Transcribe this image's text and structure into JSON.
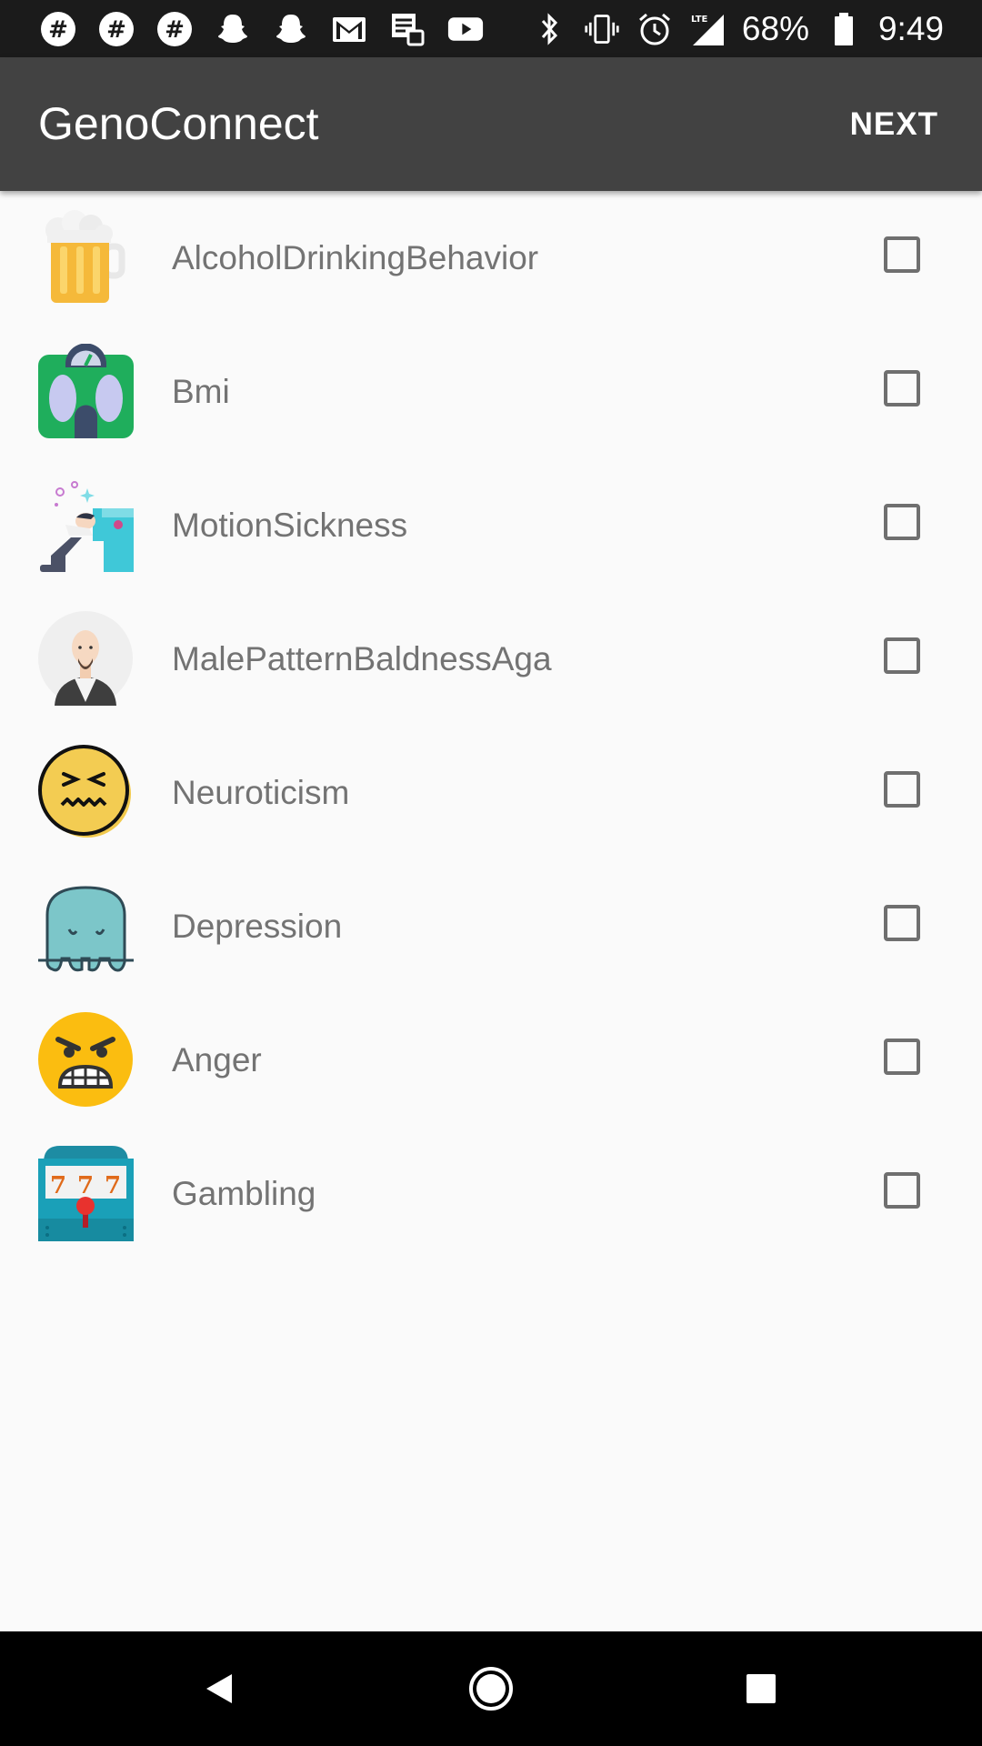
{
  "status_bar": {
    "left_icons": [
      "slack-icon",
      "slack-icon",
      "slack-icon",
      "snapchat-icon",
      "snapchat-icon",
      "gmail-icon",
      "tasks-icon",
      "youtube-icon"
    ],
    "right_icons": [
      "bluetooth-icon",
      "vibrate-icon",
      "alarm-icon",
      "lte-signal-icon"
    ],
    "battery": "68%",
    "time": "9:49"
  },
  "app_bar": {
    "title": "GenoConnect",
    "next_label": "NEXT"
  },
  "colors": {
    "app_bar": "#424242",
    "status_bar": "#1b1b1b",
    "background": "#fafafa",
    "label": "#737373",
    "checkbox_border": "#6f6f6f"
  },
  "traits": [
    {
      "label": "AlcoholDrinkingBehavior",
      "icon": "beer-mug-icon",
      "checked": false
    },
    {
      "label": "Bmi",
      "icon": "weight-scale-icon",
      "checked": false
    },
    {
      "label": "MotionSickness",
      "icon": "motion-sickness-icon",
      "checked": false
    },
    {
      "label": "MalePatternBaldnessAga",
      "icon": "bald-man-icon",
      "checked": false
    },
    {
      "label": "Neuroticism",
      "icon": "anxious-face-icon",
      "checked": false
    },
    {
      "label": "Depression",
      "icon": "sad-blob-icon",
      "checked": false
    },
    {
      "label": "Anger",
      "icon": "angry-face-icon",
      "checked": false
    },
    {
      "label": "Gambling",
      "icon": "slot-machine-icon",
      "checked": false
    }
  ],
  "nav_bar": {
    "buttons": [
      "back-icon",
      "home-icon",
      "recents-icon"
    ]
  }
}
